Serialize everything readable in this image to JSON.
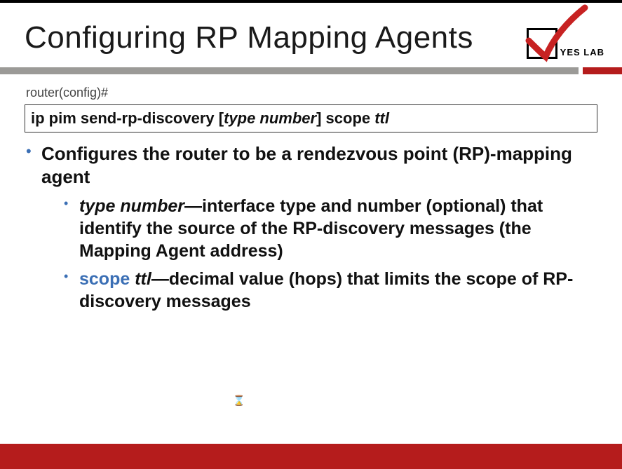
{
  "title": "Configuring RP Mapping Agents",
  "logo": {
    "text": "YES LAB"
  },
  "prompt": "router(config)#",
  "command": {
    "prefix": "ip pim send-rp-discovery [",
    "arg1": "type number",
    "mid": "] scope ",
    "arg2": "ttl"
  },
  "bullet1": "Configures the router to be a rendezvous point (RP)-mapping agent",
  "sub1": {
    "kw": "type number",
    "rest": "—interface type and number (optional) that identify the source of the RP-discovery messages (the Mapping Agent address)"
  },
  "sub2": {
    "kw1": "scope",
    "kw2": " ttl",
    "rest": "—decimal value (hops) that limits the scope of RP-discovery messages"
  },
  "cursor": "⌛"
}
